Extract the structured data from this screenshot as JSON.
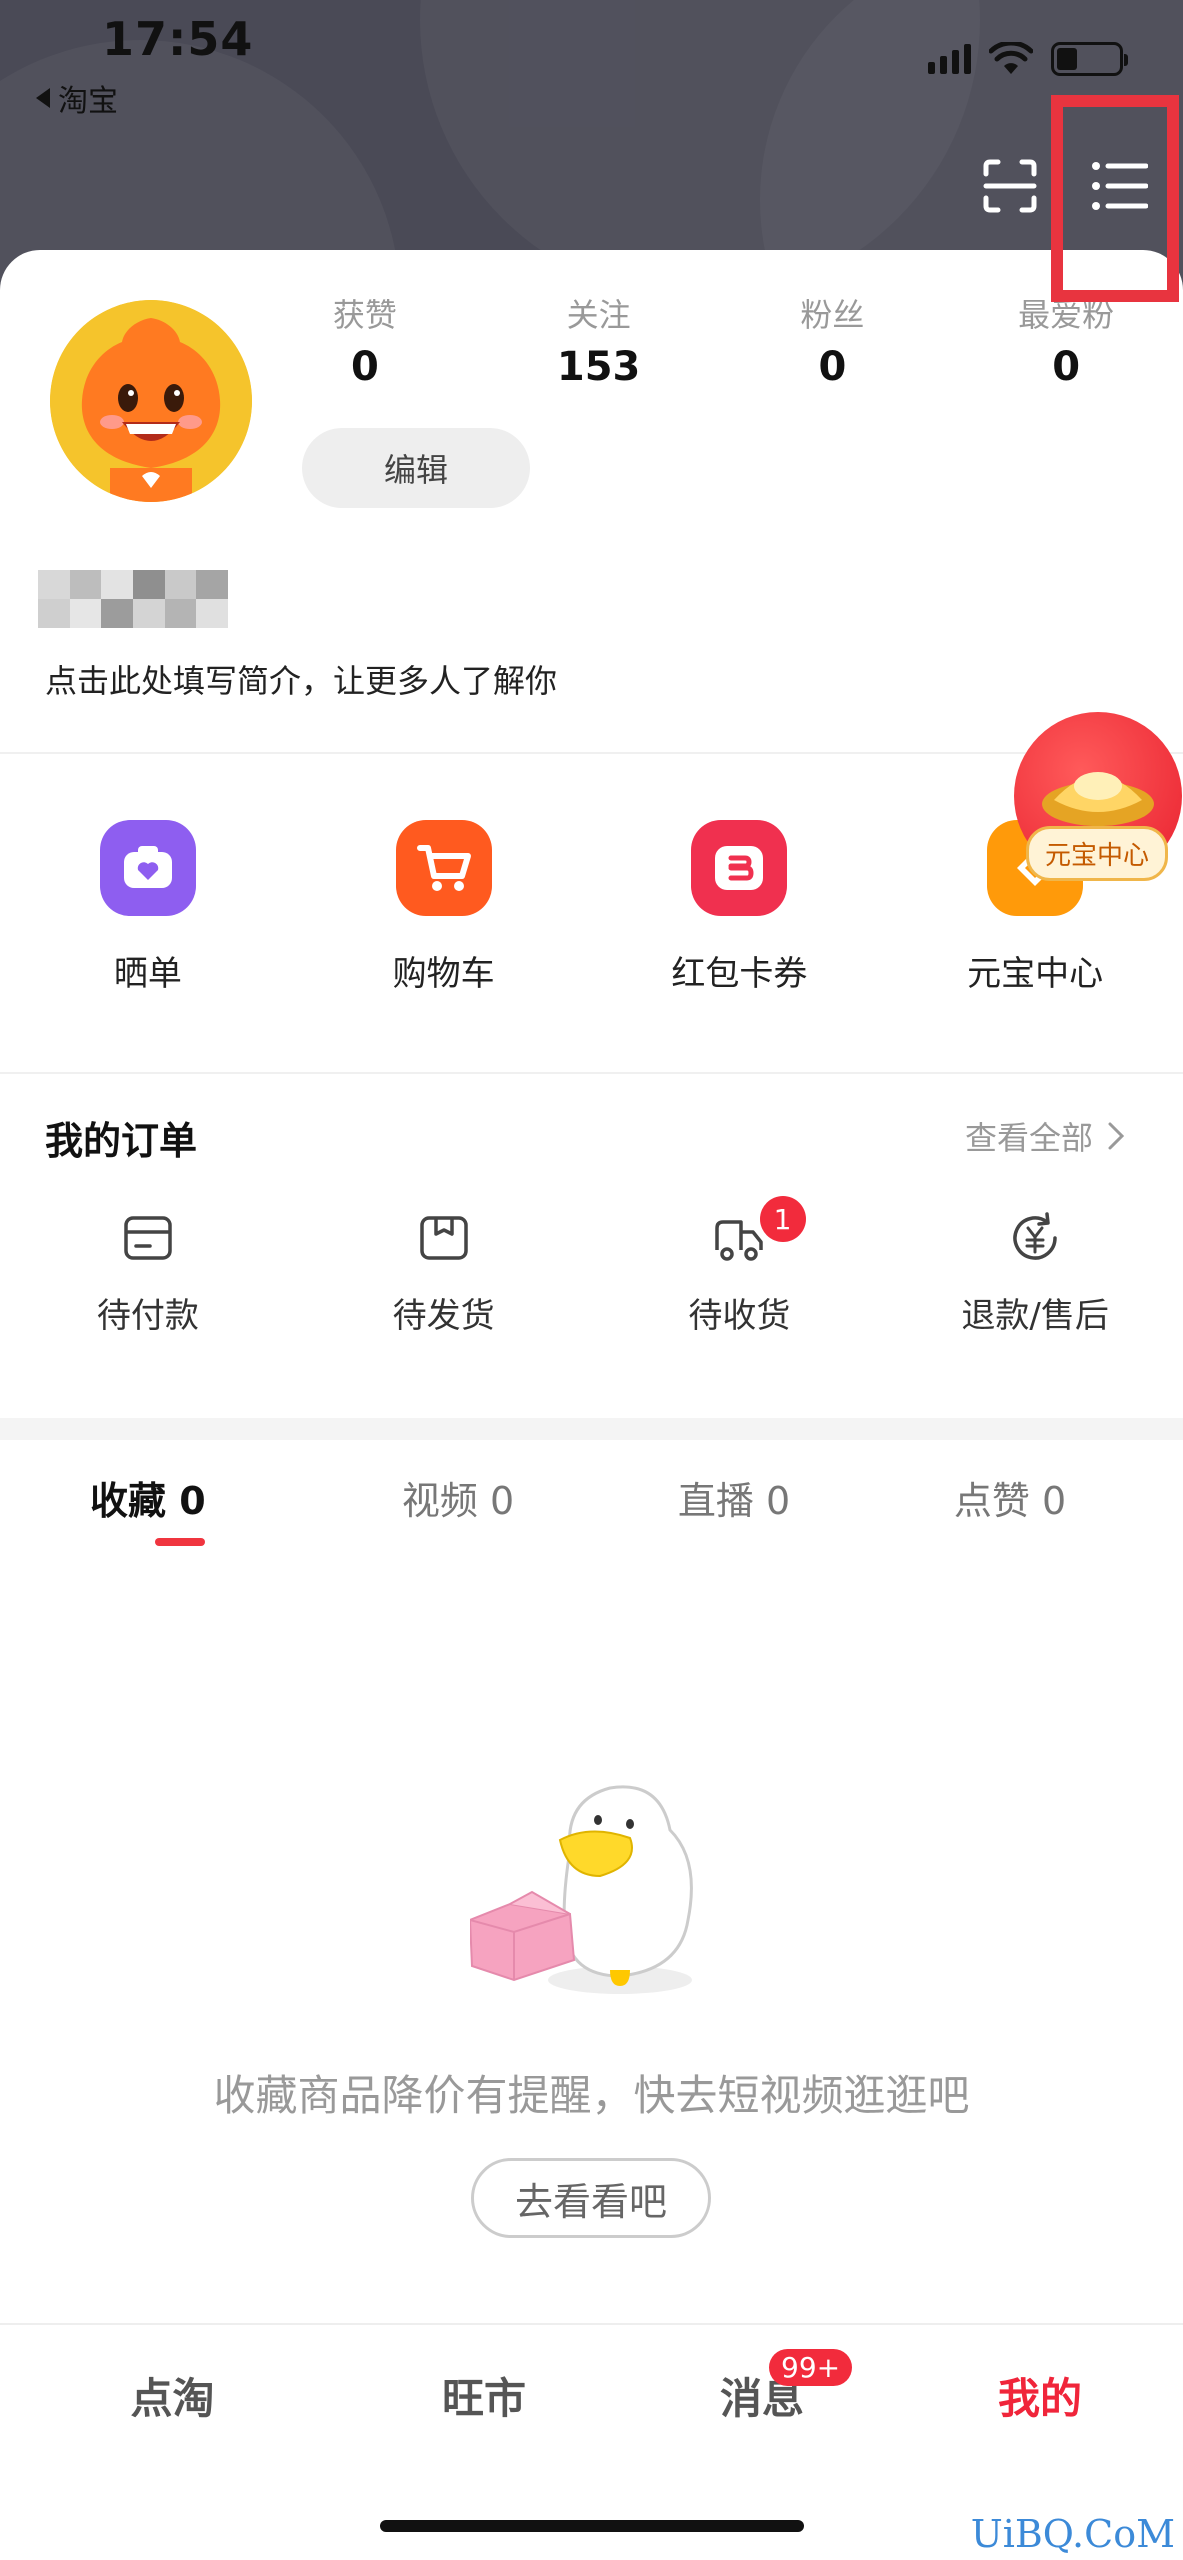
{
  "status_bar": {
    "time": "17:54",
    "back_app": "淘宝"
  },
  "profile": {
    "stats": [
      {
        "label": "获赞",
        "value": "0"
      },
      {
        "label": "关注",
        "value": "153"
      },
      {
        "label": "粉丝",
        "value": "0"
      },
      {
        "label": "最爱粉",
        "value": "0"
      }
    ],
    "edit_label": "编辑",
    "bio_placeholder": "点击此处填写简介，让更多人了解你"
  },
  "services": [
    {
      "label": "晒单",
      "color": "#8e5ef0",
      "icon": "camera-heart-icon"
    },
    {
      "label": "购物车",
      "color": "#ff5a1f",
      "icon": "cart-icon"
    },
    {
      "label": "红包卡券",
      "color": "#f0304f",
      "icon": "coupon-icon"
    },
    {
      "label": "元宝中心",
      "color": "#ff9a0a",
      "icon": "gold-ingot-icon"
    }
  ],
  "floating_badge": {
    "label": "元宝中心"
  },
  "orders": {
    "title": "我的订单",
    "view_all": "查看全部",
    "items": [
      {
        "label": "待付款",
        "icon": "wallet-icon",
        "badge": ""
      },
      {
        "label": "待发货",
        "icon": "package-icon",
        "badge": ""
      },
      {
        "label": "待收货",
        "icon": "delivery-truck-icon",
        "badge": "1"
      },
      {
        "label": "退款/售后",
        "icon": "refund-yen-icon",
        "badge": ""
      }
    ]
  },
  "tabs": [
    {
      "label": "收藏 0",
      "active": true
    },
    {
      "label": "视频 0",
      "active": false
    },
    {
      "label": "直播 0",
      "active": false
    },
    {
      "label": "点赞 0",
      "active": false
    }
  ],
  "empty_state": {
    "message": "收藏商品降价有提醒，快去短视频逛逛吧",
    "button": "去看看吧"
  },
  "bottom_nav": [
    {
      "label": "点淘",
      "active": false,
      "badge": ""
    },
    {
      "label": "旺市",
      "active": false,
      "badge": ""
    },
    {
      "label": "消息",
      "active": false,
      "badge": "99+"
    },
    {
      "label": "我的",
      "active": true,
      "badge": ""
    }
  ],
  "watermark": "UiBQ.CoM",
  "colors": {
    "header_bg": "#4a4a56",
    "accent": "#f0253a",
    "highlight_box": "#e8343f"
  }
}
